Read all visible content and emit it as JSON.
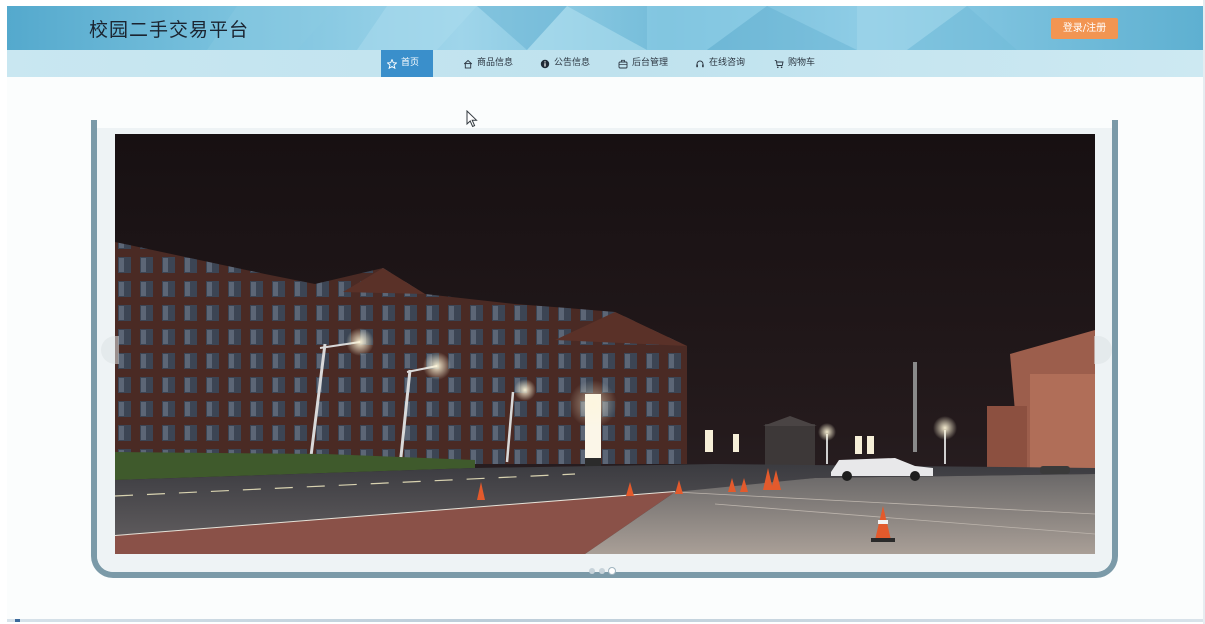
{
  "header": {
    "site_title": "校园二手交易平台",
    "login_label": "登录/注册"
  },
  "nav": {
    "items": [
      {
        "label": "首页",
        "icon": "star-icon",
        "active": true
      },
      {
        "label": "商品信息",
        "icon": "home-icon",
        "active": false
      },
      {
        "label": "公告信息",
        "icon": "info-icon",
        "active": false
      },
      {
        "label": "后台管理",
        "icon": "briefcase-icon",
        "active": false
      },
      {
        "label": "在线咨询",
        "icon": "headset-icon",
        "active": false
      },
      {
        "label": "购物车",
        "icon": "cart-icon",
        "active": false
      }
    ]
  },
  "carousel": {
    "slide_count": 3,
    "active_index": 2
  },
  "colors": {
    "header_blue": "#74bcd9",
    "nav_blue": "#c4e5ef",
    "active_nav": "#3a8fcb",
    "login_orange": "#f29552",
    "frame_gray": "#7b9aa8"
  }
}
